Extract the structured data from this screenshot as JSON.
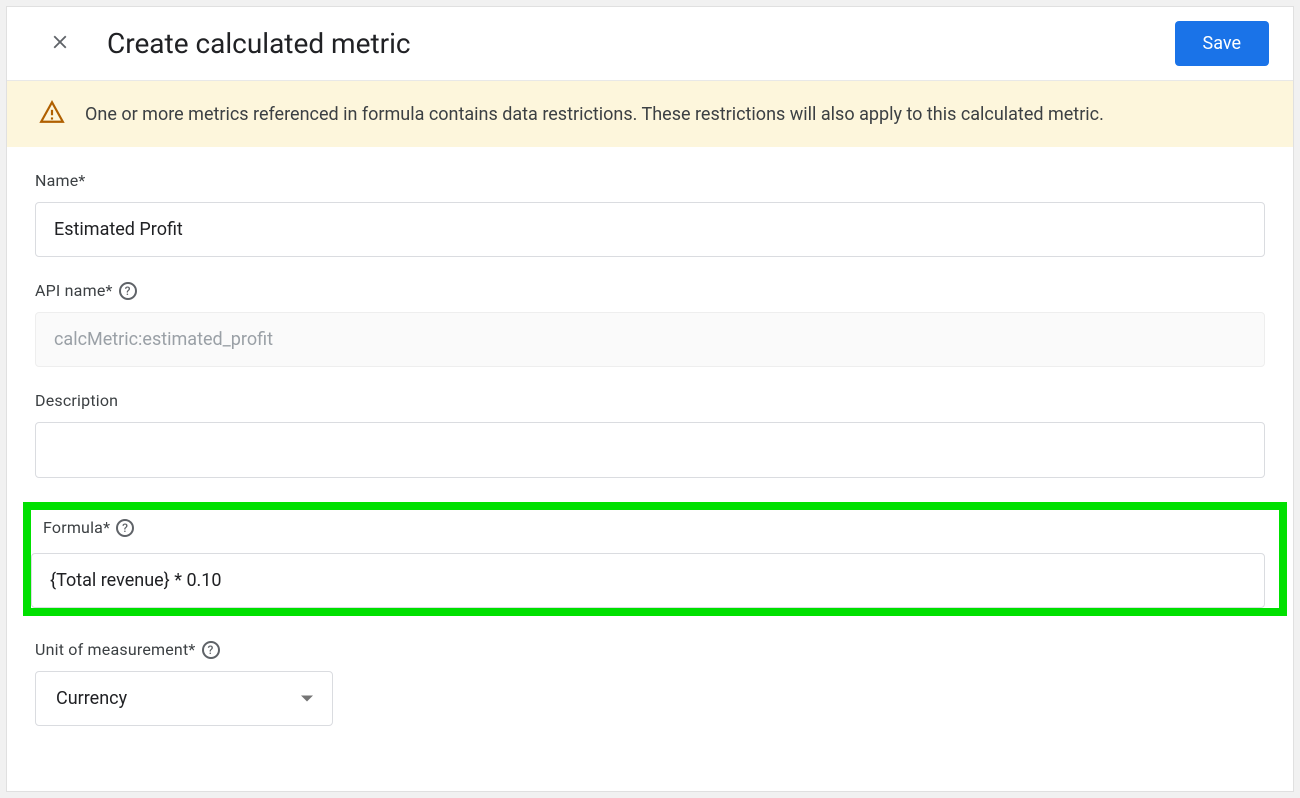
{
  "header": {
    "title": "Create calculated metric",
    "save_label": "Save"
  },
  "warning": {
    "text": "One or more metrics referenced in formula contains data restrictions. These restrictions will also apply to this calculated metric."
  },
  "fields": {
    "name": {
      "label": "Name*",
      "value": "Estimated Profit"
    },
    "api_name": {
      "label": "API name*",
      "value": "calcMetric:estimated_profit"
    },
    "description": {
      "label": "Description",
      "value": ""
    },
    "formula": {
      "label": "Formula*",
      "value": "{Total revenue} * 0.10"
    },
    "unit": {
      "label": "Unit of measurement*",
      "selected": "Currency"
    }
  }
}
